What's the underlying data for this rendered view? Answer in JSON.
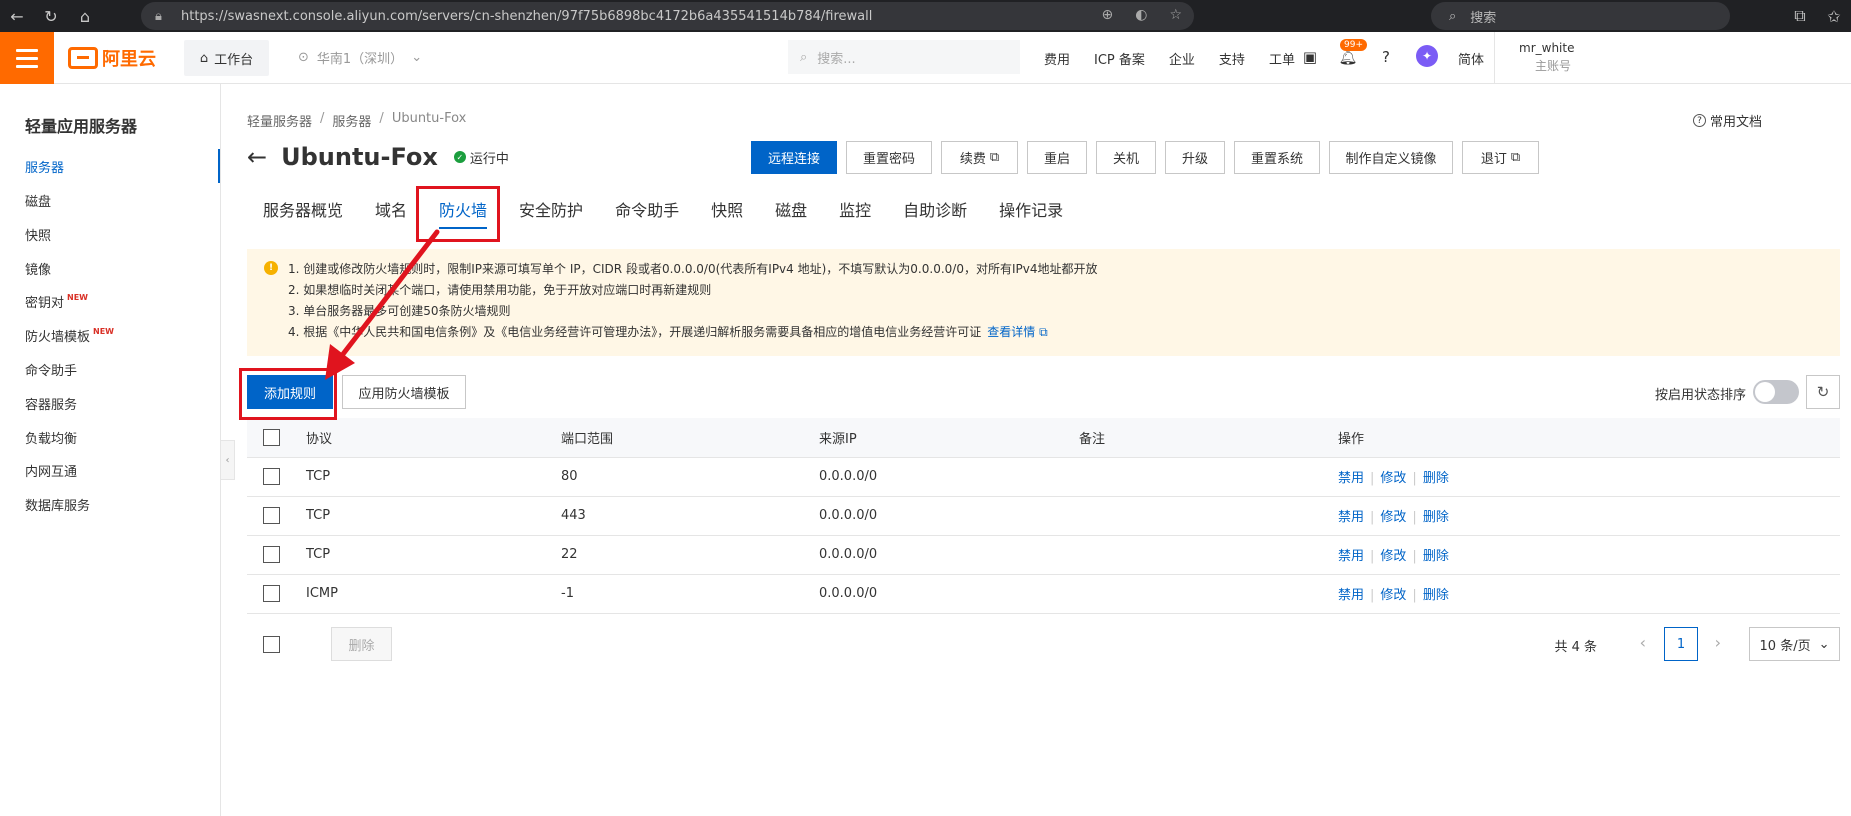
{
  "browser": {
    "url": "https://swasnext.console.aliyun.com/servers/cn-shenzhen/97f75b6898bc4172b6a435541514b784/firewall",
    "search_placeholder": "搜索"
  },
  "header": {
    "logo_text": "阿里云",
    "workbench": "工作台",
    "region": "华南1（深圳）",
    "search_placeholder": "搜索...",
    "links": [
      "费用",
      "ICP 备案",
      "企业",
      "支持",
      "工单"
    ],
    "notification_count": "99+",
    "language": "简体",
    "username": "mr_white",
    "account_type": "主账号"
  },
  "sidebar": {
    "title": "轻量应用服务器",
    "items": [
      {
        "label": "服务器",
        "new": ""
      },
      {
        "label": "磁盘",
        "new": ""
      },
      {
        "label": "快照",
        "new": ""
      },
      {
        "label": "镜像",
        "new": ""
      },
      {
        "label": "密钥对",
        "new": "NEW"
      },
      {
        "label": "防火墙模板",
        "new": "NEW"
      },
      {
        "label": "命令助手",
        "new": ""
      },
      {
        "label": "容器服务",
        "new": ""
      },
      {
        "label": "负载均衡",
        "new": ""
      },
      {
        "label": "内网互通",
        "new": ""
      },
      {
        "label": "数据库服务",
        "new": ""
      }
    ]
  },
  "breadcrumb": [
    "轻量服务器",
    "服务器",
    "Ubuntu-Fox"
  ],
  "help_doc": "常用文档",
  "page": {
    "title": "Ubuntu-Fox",
    "status": "运行中"
  },
  "actions": [
    "远程连接",
    "重置密码",
    "续费",
    "重启",
    "关机",
    "升级",
    "重置系统",
    "制作自定义镜像",
    "退订"
  ],
  "tabs": [
    "服务器概览",
    "域名",
    "防火墙",
    "安全防护",
    "命令助手",
    "快照",
    "磁盘",
    "监控",
    "自助诊断",
    "操作记录"
  ],
  "notice": {
    "lines": [
      "1. 创建或修改防火墙规则时，限制IP来源可填写单个 IP，CIDR 段或者0.0.0.0/0(代表所有IPv4 地址)，不填写默认为0.0.0.0/0，对所有IPv4地址都开放",
      "2. 如果想临时关闭某个端口，请使用禁用功能，免于开放对应端口时再新建规则",
      "3. 单台服务器最多可创建50条防火墙规则",
      "4. 根据《中华人民共和国电信条例》及《电信业务经营许可管理办法》，开展递归解析服务需要具备相应的增值电信业务经营许可证"
    ],
    "link": "查看详情"
  },
  "toolbar": {
    "add_rule": "添加规则",
    "apply_template": "应用防火墙模板",
    "sort_label": "按启用状态排序"
  },
  "table": {
    "headers": [
      "协议",
      "端口范围",
      "来源IP",
      "备注",
      "操作"
    ],
    "rows": [
      {
        "protocol": "TCP",
        "port": "80",
        "source": "0.0.0.0/0",
        "note": ""
      },
      {
        "protocol": "TCP",
        "port": "443",
        "source": "0.0.0.0/0",
        "note": ""
      },
      {
        "protocol": "TCP",
        "port": "22",
        "source": "0.0.0.0/0",
        "note": ""
      },
      {
        "protocol": "ICMP",
        "port": "-1",
        "source": "0.0.0.0/0",
        "note": ""
      }
    ],
    "ops": [
      "禁用",
      "修改",
      "删除"
    ]
  },
  "footer": {
    "delete": "删除",
    "total": "共 4 条",
    "current_page": "1",
    "page_size": "10 条/页"
  },
  "colors": {
    "accent": "#0064c8",
    "brand": "#ff6a00",
    "annotation": "#e0141e"
  }
}
